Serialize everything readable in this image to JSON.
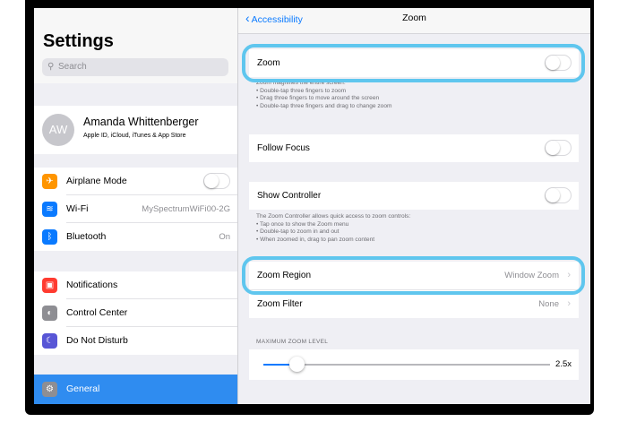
{
  "sidebar": {
    "title": "Settings",
    "search_placeholder": "Search",
    "profile": {
      "initials": "AW",
      "name": "Amanda Whittenberger",
      "subtitle": "Apple ID, iCloud, iTunes & App Store"
    },
    "connectivity": [
      {
        "label": "Airplane Mode",
        "icon": "airplane-icon",
        "color": "#ff9500"
      },
      {
        "label": "Wi-Fi",
        "value": "MySpectrumWiFi00-2G",
        "icon": "wifi-icon",
        "color": "#0a7aff"
      },
      {
        "label": "Bluetooth",
        "value": "On",
        "icon": "bluetooth-icon",
        "color": "#0a7aff"
      }
    ],
    "system": [
      {
        "label": "Notifications",
        "icon": "notifications-icon",
        "color": "#ff3b30"
      },
      {
        "label": "Control Center",
        "icon": "control-center-icon",
        "color": "#8e8e93"
      },
      {
        "label": "Do Not Disturb",
        "icon": "moon-icon",
        "color": "#5856d6"
      }
    ],
    "general": {
      "label": "General",
      "icon": "gear-icon"
    }
  },
  "nav": {
    "back_label": "Accessibility",
    "title": "Zoom"
  },
  "detail": {
    "zoom_label": "Zoom",
    "zoom_notes": [
      "Zoom magnifies the entire screen:",
      "• Double-tap three fingers to zoom",
      "• Drag three fingers to move around the screen",
      "• Double-tap three fingers and drag to change zoom"
    ],
    "follow_focus_label": "Follow Focus",
    "show_controller_label": "Show Controller",
    "controller_notes": [
      "The Zoom Controller allows quick access to zoom controls:",
      "• Tap once to show the Zoom menu",
      "• Double-tap to zoom in and out",
      "• When zoomed in, drag to pan zoom content"
    ],
    "zoom_region_label": "Zoom Region",
    "zoom_region_value": "Window Zoom",
    "zoom_filter_label": "Zoom Filter",
    "zoom_filter_value": "None",
    "max_zoom_caption": "MAXIMUM ZOOM LEVEL",
    "max_zoom_value": "2.5x"
  },
  "colors": {
    "accent": "#0a7aff",
    "highlight": "#5fc6ee",
    "selected_row": "#2f8cf0"
  }
}
